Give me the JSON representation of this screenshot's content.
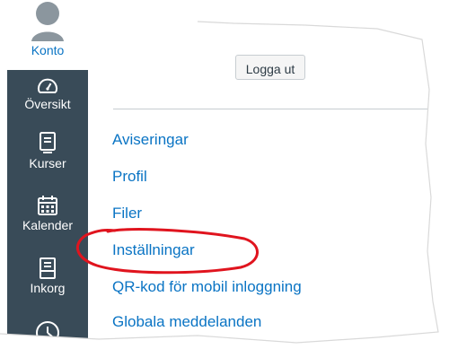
{
  "nav": {
    "account_label": "Konto",
    "items": [
      {
        "label": "Översikt",
        "icon": "dashboard-icon"
      },
      {
        "label": "Kurser",
        "icon": "book-icon"
      },
      {
        "label": "Kalender",
        "icon": "calendar-icon"
      },
      {
        "label": "Inkorg",
        "icon": "inbox-icon"
      },
      {
        "label": "",
        "icon": "clock-icon"
      }
    ]
  },
  "account_menu": {
    "logout_label": "Logga ut",
    "links": [
      "Aviseringar",
      "Profil",
      "Filer",
      "Inställningar",
      "QR-kod för mobil inloggning",
      "Globala meddelanden"
    ]
  },
  "colors": {
    "nav_bg": "#394b58",
    "link": "#0a74c4",
    "annotation": "#e0141e"
  }
}
